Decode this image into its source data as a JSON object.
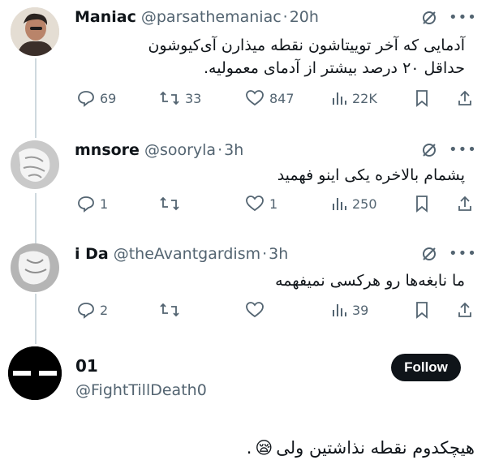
{
  "tweets": [
    {
      "name": "Maniac",
      "handle": "@parsathemaniac",
      "sep": "·",
      "time": "20h",
      "text_line1": "آدمایی که آخر توییتاشون نقطه میذارن آی‌کیوشون",
      "text_line2": "حداقل ۲۰ درصد بیشتر از آدمای معمولیه.",
      "replies": "69",
      "retweets": "33",
      "likes": "847",
      "views": "22K"
    },
    {
      "name": "mnsore",
      "handle": "@sooryla",
      "sep": "·",
      "time": "3h",
      "text_line1": "پشمام بالاخره یکی اینو فهمید",
      "replies": "1",
      "retweets": "",
      "likes": "1",
      "views": "250"
    },
    {
      "name": "i Da",
      "handle": "@theAvantgardism",
      "sep": "·",
      "time": "3h",
      "text_line1": "ما نابغه‌ها رو هرکسی نمیفهمه",
      "replies": "2",
      "retweets": "",
      "likes": "",
      "views": "39"
    }
  ],
  "profile": {
    "name": "01",
    "handle": "@FightTillDeath0",
    "follow_label": "Follow"
  },
  "caption": {
    "text": "هیچکدوم نقطه نذاشتین ولی",
    "emoji": "😪",
    "period": "."
  },
  "colors": {
    "text": "#0f1419",
    "muted": "#536471",
    "line": "#cfd9de",
    "button": "#0f1419"
  },
  "icons": [
    "reply-icon",
    "retweet-icon",
    "like-icon",
    "views-icon",
    "bookmark-icon",
    "share-icon",
    "grok-icon",
    "more-icon"
  ]
}
